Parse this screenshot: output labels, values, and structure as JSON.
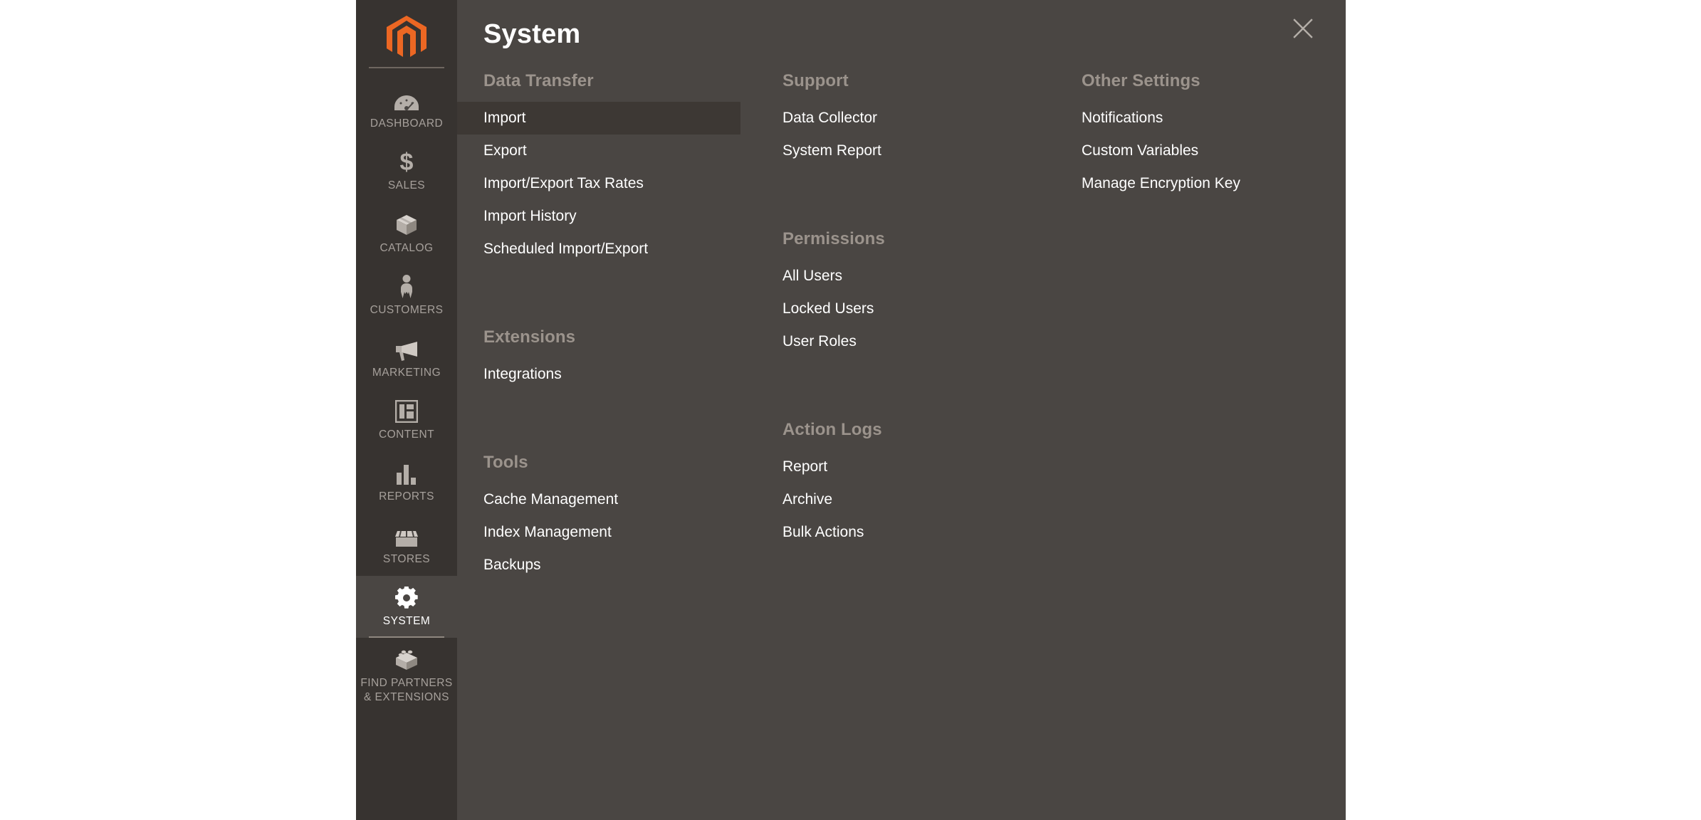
{
  "brand": {
    "logo_icon": "magento-logo-icon",
    "accent_color": "#ec6723"
  },
  "sidebar": {
    "items": [
      {
        "label": "DASHBOARD",
        "icon": "gauge-icon",
        "active": false
      },
      {
        "label": "SALES",
        "icon": "dollar-icon",
        "active": false
      },
      {
        "label": "CATALOG",
        "icon": "box-icon",
        "active": false
      },
      {
        "label": "CUSTOMERS",
        "icon": "person-icon",
        "active": false
      },
      {
        "label": "MARKETING",
        "icon": "megaphone-icon",
        "active": false
      },
      {
        "label": "CONTENT",
        "icon": "layout-icon",
        "active": false
      },
      {
        "label": "REPORTS",
        "icon": "bar-chart-icon",
        "active": false
      },
      {
        "label": "STORES",
        "icon": "storefront-icon",
        "active": false
      },
      {
        "label": "SYSTEM",
        "icon": "gear-icon",
        "active": true
      },
      {
        "label": "FIND PARTNERS\n& EXTENSIONS",
        "icon": "lego-brick-icon",
        "active": false
      }
    ]
  },
  "panel": {
    "title": "System",
    "close_icon": "close-icon",
    "columns": [
      {
        "groups": [
          {
            "title": "Data Transfer",
            "items": [
              {
                "label": "Import",
                "active": true
              },
              {
                "label": "Export",
                "active": false
              },
              {
                "label": "Import/Export Tax Rates",
                "active": false
              },
              {
                "label": "Import History",
                "active": false
              },
              {
                "label": "Scheduled Import/Export",
                "active": false
              }
            ]
          },
          {
            "title": "Extensions",
            "items": [
              {
                "label": "Integrations",
                "active": false
              }
            ]
          },
          {
            "title": "Tools",
            "items": [
              {
                "label": "Cache Management",
                "active": false
              },
              {
                "label": "Index Management",
                "active": false
              },
              {
                "label": "Backups",
                "active": false
              }
            ]
          }
        ]
      },
      {
        "groups": [
          {
            "title": "Support",
            "items": [
              {
                "label": "Data Collector",
                "active": false
              },
              {
                "label": "System Report",
                "active": false
              }
            ]
          },
          {
            "title": "Permissions",
            "items": [
              {
                "label": "All Users",
                "active": false
              },
              {
                "label": "Locked Users",
                "active": false
              },
              {
                "label": "User Roles",
                "active": false
              }
            ]
          },
          {
            "title": "Action Logs",
            "items": [
              {
                "label": "Report",
                "active": false
              },
              {
                "label": "Archive",
                "active": false
              },
              {
                "label": "Bulk Actions",
                "active": false
              }
            ]
          }
        ]
      },
      {
        "groups": [
          {
            "title": "Other Settings",
            "items": [
              {
                "label": "Notifications",
                "active": false
              },
              {
                "label": "Custom Variables",
                "active": false
              },
              {
                "label": "Manage Encryption Key",
                "active": false
              }
            ]
          }
        ]
      }
    ]
  }
}
